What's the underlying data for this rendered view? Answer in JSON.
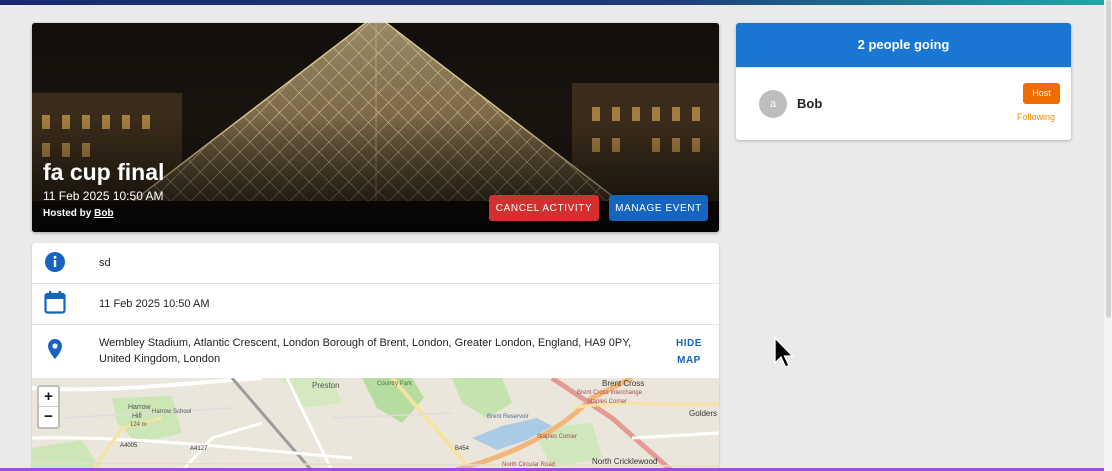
{
  "event": {
    "title": "fa cup final",
    "date": "11 Feb 2025 10:50 AM",
    "hosted_by_prefix": "Hosted by",
    "host_name": "Bob",
    "cancel_label": "CANCEL ACTIVITY",
    "manage_label": "MANAGE EVENT"
  },
  "details": {
    "description": "sd",
    "date": "11 Feb 2025 10:50 AM",
    "location": "Wembley Stadium, Atlantic Crescent, London Borough of Brent, London, Greater London, England, HA9 0PY, United Kingdom, London",
    "hide_map_line1": "HIDE",
    "hide_map_line2": "MAP"
  },
  "map": {
    "zoom_in": "+",
    "zoom_out": "−",
    "labels": [
      "Preston",
      "Country Park",
      "Harrow",
      "Hill",
      "Harrow School",
      "124 m",
      "A4005",
      "A4127",
      "B454",
      "Brent Reservoir",
      "Staples Corner",
      "Brent Cross",
      "Brent Cross Interchange",
      "Staples Corner",
      "North Circular Road",
      "North Cricklewood",
      "Golders"
    ]
  },
  "attendees": {
    "header": "2 people going",
    "list": [
      {
        "avatar_letter": "a",
        "name": "Bob",
        "badge": "Host",
        "status": "Following"
      }
    ]
  },
  "colors": {
    "primary": "#1976d2",
    "danger": "#d32f2f",
    "host_badge": "#ef6c00"
  },
  "icons": [
    "info-icon",
    "calendar-icon",
    "location-pin-icon"
  ]
}
